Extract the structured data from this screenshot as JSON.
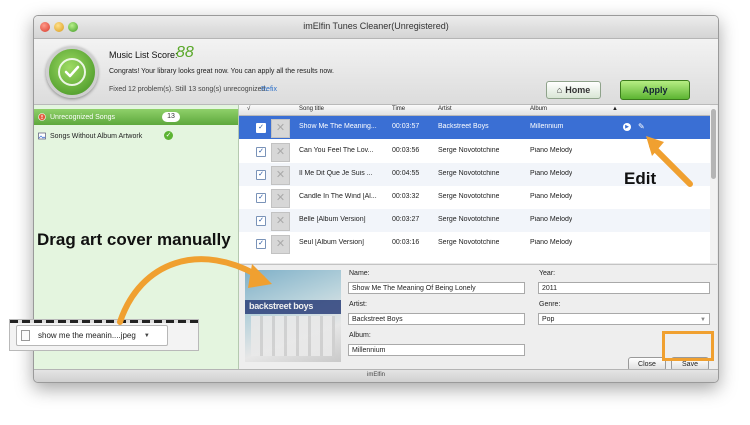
{
  "window": {
    "title": "imElfin Tunes Cleaner(Unregistered)"
  },
  "header": {
    "score_label": "Music List Score:",
    "score_value": "88",
    "congrats_text": "Congrats! Your library looks great now. You can apply all the results now.",
    "fixed_text": "Fixed 12 problem(s). Still 13 song(s) unrecognized.",
    "refix_link": "Refix",
    "home_button": "Home",
    "apply_button": "Apply"
  },
  "sidebar": {
    "items": [
      {
        "label": "Unrecognized Songs",
        "badge": "13",
        "icon": "warning-icon"
      },
      {
        "label": "Songs Without Album Artwork",
        "icon": "image-icon",
        "status": "check-icon"
      }
    ]
  },
  "table": {
    "columns": [
      "√",
      "Song title",
      "Time",
      "Artist",
      "Album"
    ],
    "sort_indicator": "▲",
    "rows": [
      {
        "title": "Show Me The Meaning...",
        "time": "00:03:57",
        "artist": "Backstreet Boys",
        "album": "Millennium",
        "selected": true
      },
      {
        "title": "Can You Feel The Lov...",
        "time": "00:03:56",
        "artist": "Serge Novototchine",
        "album": "Piano Melody"
      },
      {
        "title": "Il Me Dit Que Je Suis ...",
        "time": "00:04:55",
        "artist": "Serge Novototchine",
        "album": "Piano Melody"
      },
      {
        "title": "Candle In The Wind [Al...",
        "time": "00:03:32",
        "artist": "Serge Novototchine",
        "album": "Piano Melody"
      },
      {
        "title": "Belle [Album Version]",
        "time": "00:03:27",
        "artist": "Serge Novototchine",
        "album": "Piano Melody"
      },
      {
        "title": "Seul [Album Version]",
        "time": "00:03:16",
        "artist": "Serge Novototchine",
        "album": "Piano Melody"
      }
    ]
  },
  "editor": {
    "name_label": "Name:",
    "name_value": "Show Me The Meaning Of Being Lonely",
    "artist_label": "Artist:",
    "artist_value": "Backstreet Boys",
    "album_label": "Album:",
    "album_value": "Millennium",
    "year_label": "Year:",
    "year_value": "2011",
    "genre_label": "Genre:",
    "genre_value": "Pop",
    "close_button": "Close",
    "save_button": "Save",
    "cover_text": "backstreet boys",
    "cover_subtext": "millennium"
  },
  "statusbar": {
    "text": "imElfin"
  },
  "annotations": {
    "drag_label": "Drag art cover manually",
    "edit_label": "Edit",
    "accent_color": "#f0a030"
  },
  "file_chip": {
    "filename": "show me the meanin....jpeg"
  }
}
